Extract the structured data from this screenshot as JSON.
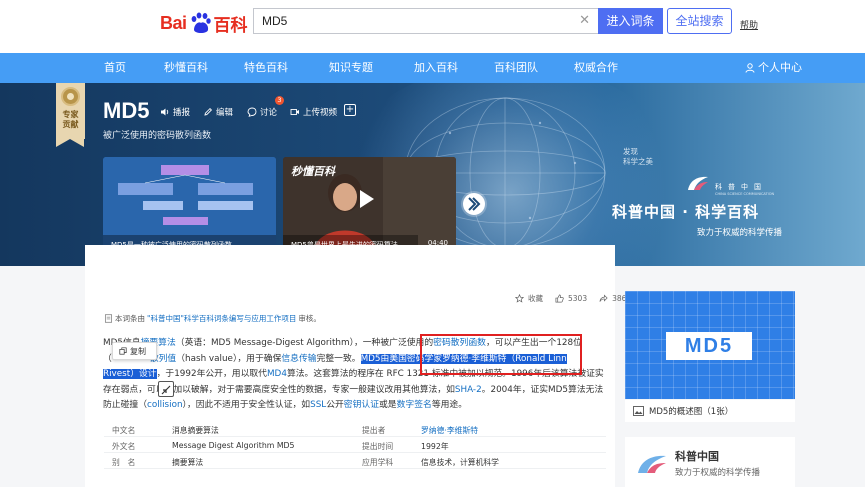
{
  "header": {
    "logo_bai": "Bai",
    "logo_du": "du",
    "logo_baike": "百科",
    "search_value": "MD5",
    "enter_button": "进入词条",
    "all_search_button": "全站搜索",
    "help_link": "帮助"
  },
  "nav": {
    "items": [
      "首页",
      "秒懂百科",
      "特色百科",
      "知识专题",
      "加入百科",
      "百科团队",
      "权威合作"
    ],
    "user_center": "个人中心"
  },
  "hero": {
    "ribbon_text": "专家贡献",
    "title": "MD5",
    "subtitle": "被广泛使用的密码散列函数",
    "tools": {
      "broadcast": "播报",
      "edit": "编辑",
      "discuss": "讨论",
      "discuss_badge": "3",
      "upload_video": "上传视频"
    },
    "video1": {
      "caption": "MD5是一种被广泛使用的密码散列函数"
    },
    "video2": {
      "brand": "秒懂百科",
      "caption": "MD5曾是世界上最先进的密码算法，…",
      "duration": "04:40"
    },
    "discover": "发现",
    "discover_sub": "科学之美",
    "kp_small": "科普中国",
    "kp_small_en": "CHINA SCIENCE COMMUNICATION",
    "kp_big": "科普中国 · 科学百科",
    "kp_tagline": "致力于权威的科学传播"
  },
  "stats": {
    "favorites_label": "收藏",
    "likes": "5303",
    "shares": "386"
  },
  "review_note": {
    "prefix": "本词条由",
    "link": "\"科普中国\"科学百科词条编写与应用工作项目",
    "suffix": "审核。"
  },
  "paragraph": {
    "l1_a": "MD5信息",
    "l1_link1": "摘要算法",
    "l1_b": "（英语：MD5 Message-Digest Algorithm），一种被广泛使用的",
    "l1_link2": "密码散列函数",
    "l1_c": "，可以产生出一个128位",
    "l2_a": "（",
    "l2_link1": "散列值",
    "l2_b": "（hash value），用于确保",
    "l2_link2": "信息传输",
    "l2_c": "完整一致。",
    "l2_sel": "MD5由美国密码学家罗纳德·李维斯特（Ronald Linn",
    "l3_sel": "Rivest）设计",
    "l3_a": "，于1992年公开，用以取代",
    "l3_link1": "MD4",
    "l3_b": "算法。这套算法的程序在 RFC 1321 标准中被加以规范。1996年后该算法被证实",
    "l4_a": "存在弱点，可以被加以破解，对于需要高度安全性的数据，专家一般建议改用其他算法，如",
    "l4_link1": "SHA-2",
    "l4_b": "。2004年，证实MD5算法无法",
    "l5_a": "防止碰撞（",
    "l5_link1": "collision",
    "l5_b": "），因此不适用于安全性认证，如",
    "l5_link2": "SSL",
    "l5_c": "公开",
    "l5_link3": "密钥认证",
    "l5_d": "或是",
    "l5_link4": "数字签名",
    "l5_e": "等用途。"
  },
  "copy_popup": "复制",
  "info": [
    {
      "l1": "中文名",
      "v1": "消息摘要算法",
      "l2": "提出者",
      "v2": "罗纳德·李维斯特"
    },
    {
      "l1": "外文名",
      "v1": "Message Digest Algorithm MD5",
      "l2": "提出时间",
      "v2": "1992年"
    },
    {
      "l1": "别　名",
      "v1": "摘要算法",
      "l2": "应用学科",
      "v2": "信息技术，计算机科学"
    }
  ],
  "sidebar": {
    "album_label": "MD5",
    "album_caption": "MD5的概述图（1张）",
    "kp_title": "科普中国",
    "kp_sub": "致力于权威的科学传播"
  },
  "colors": {
    "brand_blue": "#4e6ef2",
    "nav_blue": "#459df5",
    "link": "#136ec2",
    "selection": "#1a5fd6",
    "highlight_box": "#e02020"
  }
}
